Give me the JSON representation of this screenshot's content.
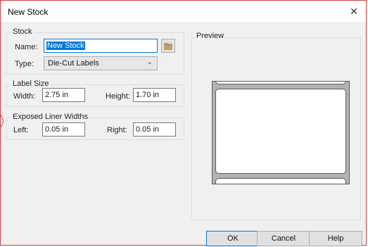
{
  "window": {
    "title": "New Stock",
    "close_glyph": "✕"
  },
  "stock": {
    "group_label": "Stock",
    "name_label": "Name:",
    "name_value": "New Stock",
    "type_label": "Type:",
    "type_value": "Die-Cut Labels",
    "browse_icon": "folder-browse-icon"
  },
  "label_size": {
    "group_label": "Label Size",
    "width_label": "Width:",
    "width_value": "2.75 in",
    "height_label": "Height:",
    "height_value": "1.70 in"
  },
  "liner": {
    "group_label": "Exposed Liner Widths",
    "left_label": "Left:",
    "left_value": "0.05 in",
    "right_label": "Right:",
    "right_value": "0.05 in"
  },
  "preview": {
    "group_label": "Preview"
  },
  "buttons": {
    "ok": "OK",
    "cancel": "Cancel",
    "help": "Help"
  },
  "colors": {
    "accent": "#0078d7",
    "liner": "#b3b3b3",
    "label": "#ffffff"
  }
}
